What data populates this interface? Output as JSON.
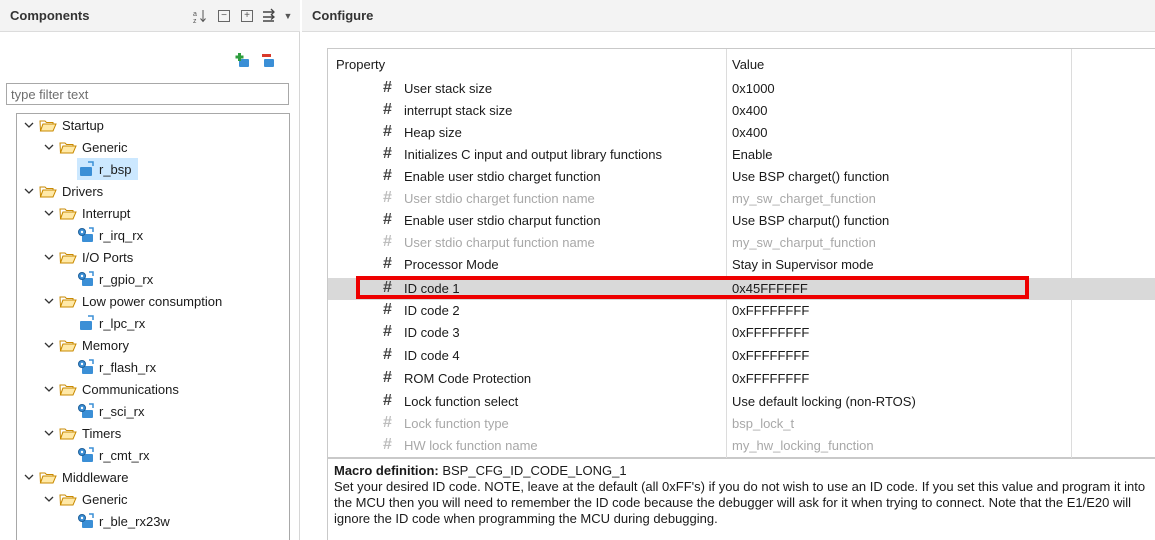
{
  "components_panel": {
    "title": "Components",
    "toolbar_icons": [
      "sort-az-icon",
      "collapse-all-icon",
      "expand-all-icon",
      "filter-arrows-icon",
      "dropdown-triangle-icon",
      "add-component-icon",
      "remove-component-icon"
    ],
    "filter_placeholder": "type filter text",
    "tree": [
      {
        "label": "Startup",
        "type": "folder",
        "level": 0
      },
      {
        "label": "Generic",
        "type": "folder",
        "level": 1
      },
      {
        "label": "r_bsp",
        "type": "leaf",
        "icon": "component-blue-icon",
        "level": 2
      },
      {
        "label": "Drivers",
        "type": "folder",
        "level": 0
      },
      {
        "label": "Interrupt",
        "type": "folder",
        "level": 1
      },
      {
        "label": "r_irq_rx",
        "type": "leaf",
        "icon": "component-gear-icon",
        "level": 2
      },
      {
        "label": "I/O Ports",
        "type": "folder",
        "level": 1
      },
      {
        "label": "r_gpio_rx",
        "type": "leaf",
        "icon": "component-gear-icon",
        "level": 2
      },
      {
        "label": "Low power consumption",
        "type": "folder",
        "level": 1
      },
      {
        "label": "r_lpc_rx",
        "type": "leaf",
        "icon": "component-blue-icon",
        "level": 2
      },
      {
        "label": "Memory",
        "type": "folder",
        "level": 1
      },
      {
        "label": "r_flash_rx",
        "type": "leaf",
        "icon": "component-gear-icon",
        "level": 2
      },
      {
        "label": "Communications",
        "type": "folder",
        "level": 1
      },
      {
        "label": "r_sci_rx",
        "type": "leaf",
        "icon": "component-gear-icon",
        "level": 2
      },
      {
        "label": "Timers",
        "type": "folder",
        "level": 1
      },
      {
        "label": "r_cmt_rx",
        "type": "leaf",
        "icon": "component-gear-icon",
        "level": 2
      },
      {
        "label": "Middleware",
        "type": "folder",
        "level": 0
      },
      {
        "label": "Generic",
        "type": "folder",
        "level": 1
      },
      {
        "label": "r_ble_rx23w",
        "type": "leaf",
        "icon": "component-gear-icon",
        "level": 2
      }
    ]
  },
  "configure_panel": {
    "title": "Configure",
    "columns": {
      "property": "Property",
      "value": "Value"
    },
    "rows": [
      {
        "property": "User stack size",
        "value": "0x1000",
        "enabled": true
      },
      {
        "property": "interrupt stack size",
        "value": "0x400",
        "enabled": true
      },
      {
        "property": "Heap size",
        "value": "0x400",
        "enabled": true
      },
      {
        "property": "Initializes C input and output library functions",
        "value": "Enable",
        "enabled": true
      },
      {
        "property": "Enable user stdio charget function",
        "value": "Use BSP charget() function",
        "enabled": true
      },
      {
        "property": "User stdio charget function name",
        "value": "my_sw_charget_function",
        "enabled": false
      },
      {
        "property": "Enable user stdio charput function",
        "value": "Use BSP charput() function",
        "enabled": true
      },
      {
        "property": "User stdio charput function name",
        "value": "my_sw_charput_function",
        "enabled": false
      },
      {
        "property": "Processor Mode",
        "value": "Stay in Supervisor mode",
        "enabled": true
      },
      {
        "property": "ID code 1",
        "value": "0x45FFFFFF",
        "enabled": true,
        "selected": true
      },
      {
        "property": "ID code 2",
        "value": "0xFFFFFFFF",
        "enabled": true
      },
      {
        "property": "ID code 3",
        "value": "0xFFFFFFFF",
        "enabled": true
      },
      {
        "property": "ID code 4",
        "value": "0xFFFFFFFF",
        "enabled": true
      },
      {
        "property": "ROM Code Protection",
        "value": "0xFFFFFFFF",
        "enabled": true
      },
      {
        "property": "Lock function select",
        "value": "Use default locking (non-RTOS)",
        "enabled": true
      },
      {
        "property": "Lock function type",
        "value": "bsp_lock_t",
        "enabled": false
      },
      {
        "property": "HW lock function name",
        "value": "my_hw_locking_function",
        "enabled": false
      }
    ],
    "highlight_color": "#ee0000",
    "description": {
      "label": "Macro definition:",
      "macro": "BSP_CFG_ID_CODE_LONG_1",
      "text": "Set your desired ID code. NOTE, leave at the default (all 0xFF's) if you do not wish to use an ID code. If you set this value and program it into the MCU then you will need to remember the ID code because the debugger will ask for it when trying to connect. Note that the E1/E20 will ignore the ID code when programming the MCU during debugging."
    }
  }
}
